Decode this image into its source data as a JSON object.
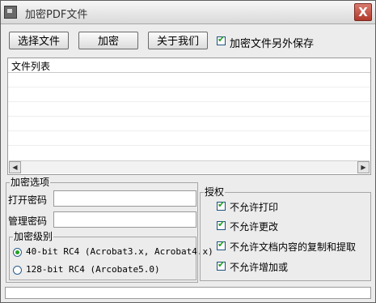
{
  "window": {
    "title": "加密PDF文件",
    "close_glyph": "X"
  },
  "toolbar": {
    "select_file_label": "选择文件",
    "encrypt_label": "加密",
    "about_label": "关于我们",
    "save_separately_label": "加密文件另外保存",
    "save_separately_checked": true
  },
  "file_list": {
    "header": "文件列表",
    "rows": []
  },
  "encrypt_options": {
    "legend": "加密选项",
    "open_password_label": "打开密码",
    "open_password_value": "",
    "admin_password_label": "管理密码",
    "admin_password_value": "",
    "level": {
      "legend": "加密级别",
      "options": [
        {
          "label": "40-bit RC4 (Acrobat3.x, Acrobat4.x)",
          "selected": true
        },
        {
          "label": "128-bit RC4 (Arcobate5.0)",
          "selected": false
        }
      ]
    }
  },
  "permissions": {
    "legend": "授权",
    "items": [
      {
        "label": "不允许打印",
        "checked": true
      },
      {
        "label": "不允许更改",
        "checked": true
      },
      {
        "label": "不允许文档内容的复制和提取",
        "checked": true
      },
      {
        "label": "不允许增加或",
        "checked": true
      }
    ]
  },
  "status": {
    "text": ""
  },
  "colors": {
    "check_green": "#21a121",
    "close_red": "#b0382a"
  }
}
